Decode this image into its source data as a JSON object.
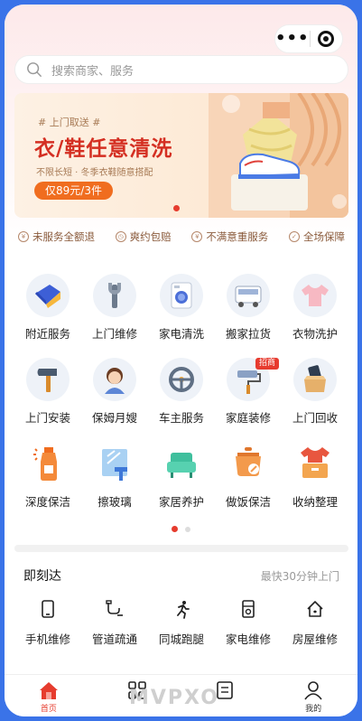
{
  "capsule": {
    "more": "•••"
  },
  "search": {
    "placeholder": "搜索商家、服务"
  },
  "banner": {
    "tag": "# 上门取送 #",
    "title": "衣/鞋任意清洗",
    "subtitle": "不限长短 · 冬季衣鞋随意搭配",
    "price_button": "仅89元/3件"
  },
  "guarantees": [
    "未服务全额退",
    "爽约包赔",
    "不满意重服务",
    "全场保障"
  ],
  "categories": [
    {
      "label": "附近服务",
      "icon": "location-package-icon"
    },
    {
      "label": "上门维修",
      "icon": "wrench-icon"
    },
    {
      "label": "家电清洗",
      "icon": "washing-machine-icon"
    },
    {
      "label": "搬家拉货",
      "icon": "truck-icon"
    },
    {
      "label": "衣物洗护",
      "icon": "shirt-icon"
    },
    {
      "label": "上门安装",
      "icon": "hammer-icon"
    },
    {
      "label": "保姆月嫂",
      "icon": "nanny-icon"
    },
    {
      "label": "车主服务",
      "icon": "steering-wheel-icon"
    },
    {
      "label": "家庭装修",
      "icon": "paint-roller-icon",
      "badge": "招商"
    },
    {
      "label": "上门回收",
      "icon": "recycle-box-icon"
    },
    {
      "label": "深度保洁",
      "icon": "spray-bottle-icon"
    },
    {
      "label": "擦玻璃",
      "icon": "glass-wiper-icon"
    },
    {
      "label": "家居养护",
      "icon": "sofa-icon"
    },
    {
      "label": "做饭保洁",
      "icon": "cooking-pot-icon"
    },
    {
      "label": "收纳整理",
      "icon": "storage-box-icon"
    }
  ],
  "quick": {
    "title": "即刻达",
    "more": "最快30分钟上门",
    "items": [
      {
        "label": "手机维修",
        "icon": "phone-icon"
      },
      {
        "label": "管道疏通",
        "icon": "pipe-icon"
      },
      {
        "label": "同城跑腿",
        "icon": "runner-icon"
      },
      {
        "label": "家电维修",
        "icon": "appliance-icon"
      },
      {
        "label": "房屋维修",
        "icon": "house-icon"
      }
    ]
  },
  "tabs": [
    {
      "label": "首页",
      "icon": "home-icon"
    },
    {
      "label": "",
      "icon": "grid-icon"
    },
    {
      "label": "",
      "icon": "list-icon"
    },
    {
      "label": "我的",
      "icon": "profile-icon"
    }
  ],
  "watermark": "MVPXO",
  "colors": {
    "accent": "#e63c2e",
    "orange": "#f06d1f",
    "bg_blue": "#3a73e8"
  }
}
